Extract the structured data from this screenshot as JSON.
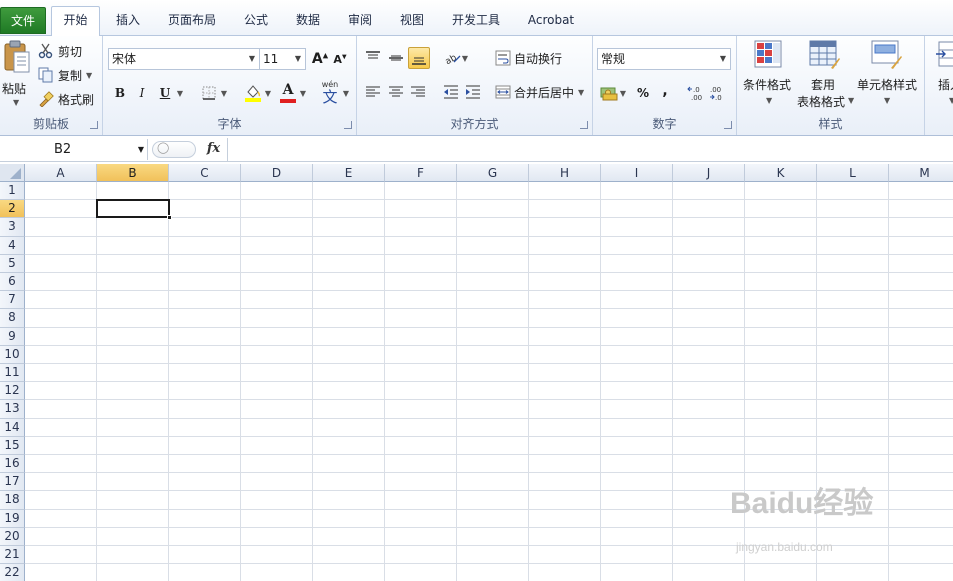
{
  "tabs": {
    "file": "文件",
    "items": [
      "开始",
      "插入",
      "页面布局",
      "公式",
      "数据",
      "审阅",
      "视图",
      "开发工具",
      "Acrobat"
    ]
  },
  "clipboard": {
    "paste": "粘贴",
    "cut": "剪切",
    "copy": "复制",
    "format_painter": "格式刷",
    "label": "剪贴板"
  },
  "font": {
    "name": "宋体",
    "size": "11",
    "bold": "B",
    "italic": "I",
    "underline": "U",
    "font_color_glyph": "A",
    "wen": "wén",
    "wen_char": "文",
    "label": "字体"
  },
  "alignment": {
    "wrap_text": "自动换行",
    "merge_center": "合并后居中",
    "label": "对齐方式"
  },
  "number": {
    "format": "常规",
    "percent": "%",
    "comma": ",",
    "label": "数字"
  },
  "styles": {
    "conditional": "条件格式",
    "table_line1": "套用",
    "table_line2": "表格格式",
    "cell_styles": "单元格样式",
    "label": "样式"
  },
  "cells_group": {
    "insert": "插入"
  },
  "formula_bar": {
    "name_box": "B2",
    "fx": "fx",
    "content": ""
  },
  "sheet": {
    "columns": [
      "A",
      "B",
      "C",
      "D",
      "E",
      "F",
      "G",
      "H",
      "I",
      "J",
      "K",
      "L",
      "M"
    ],
    "rows": [
      "1",
      "2",
      "3",
      "4",
      "5",
      "6",
      "7",
      "8",
      "9",
      "10",
      "11",
      "12",
      "13",
      "14",
      "15",
      "16",
      "17",
      "18",
      "19",
      "20",
      "21",
      "22"
    ],
    "selected_cell": "B2"
  },
  "watermark": {
    "brand": "Baidu经验",
    "url": "jingyan.baidu.com"
  },
  "colors": {
    "file_tab": "#2a8a31",
    "selection_header": "#f5cc6a",
    "font_color": "#e02020",
    "highlight": "#ffff00"
  }
}
